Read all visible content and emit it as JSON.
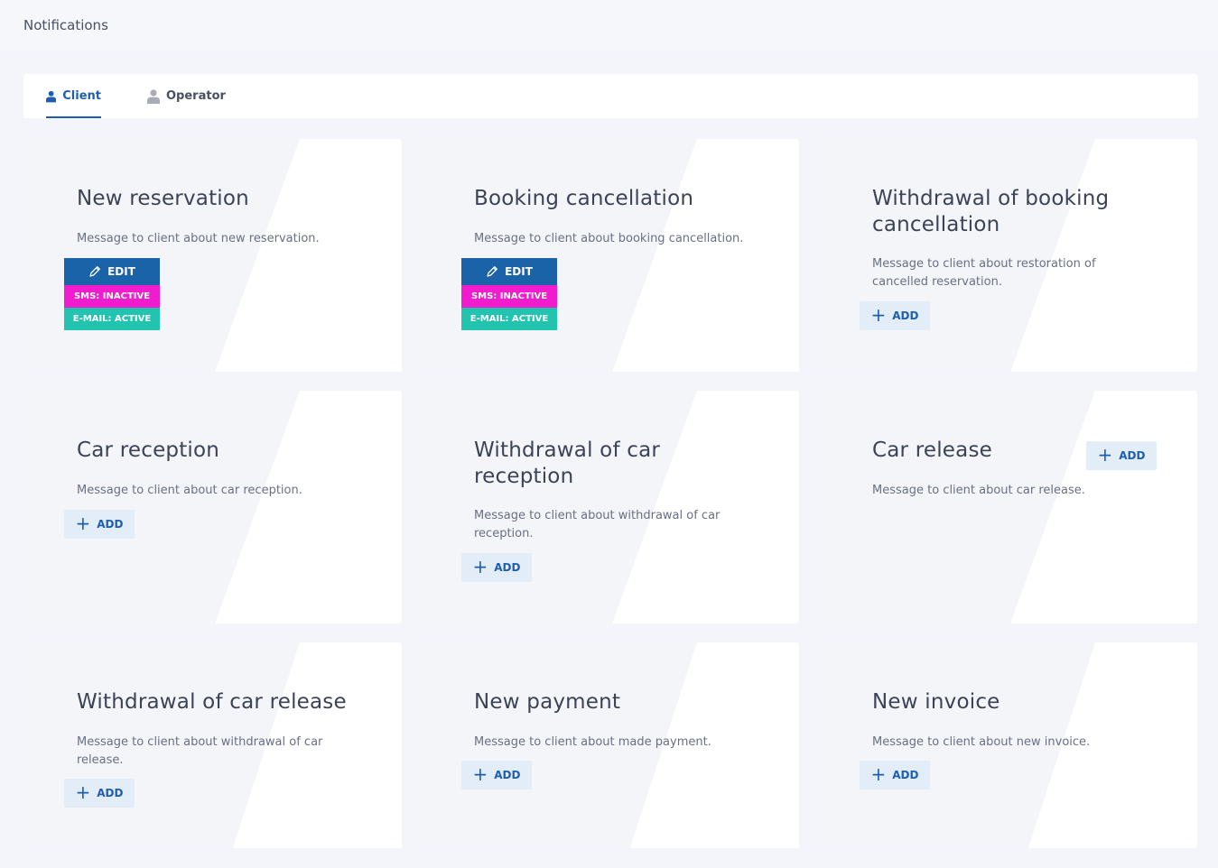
{
  "page": {
    "title": "Notifications"
  },
  "tabs": [
    {
      "label": "Client",
      "icon": "person-icon",
      "active": true
    },
    {
      "label": "Operator",
      "icon": "person-icon",
      "active": false
    }
  ],
  "colors": {
    "accent": "#1d5fae",
    "edit": "#1a63a8",
    "sms_inactive": "#f21ccf",
    "email_active": "#22c4b0",
    "add_bg": "#e2edf7"
  },
  "cards": [
    {
      "title": "New reservation",
      "description": "Message to client about new reservation.",
      "edit_label": "EDIT",
      "sms_label": "SMS: INACTIVE",
      "email_label": "E-MAIL: ACTIVE"
    },
    {
      "title": "Booking cancellation",
      "description": "Message to client about booking cancellation.",
      "edit_label": "EDIT",
      "sms_label": "SMS: INACTIVE",
      "email_label": "E-MAIL: ACTIVE"
    },
    {
      "title": "Withdrawal of booking cancellation",
      "description": "Message to client about restoration of cancelled reservation.",
      "add_label": "ADD"
    },
    {
      "title": "Car reception",
      "description": "Message to client about car reception.",
      "add_label": "ADD"
    },
    {
      "title": "Withdrawal of car reception",
      "description": "Message to client about withdrawal of car reception.",
      "add_label": "ADD"
    },
    {
      "title": "Car release",
      "description": "Message to client about car release.",
      "add_label": "ADD"
    },
    {
      "title": "Withdrawal of car release",
      "description": "Message to client about withdrawal of car release.",
      "add_label": "ADD"
    },
    {
      "title": "New payment",
      "description": "Message to client about made payment.",
      "add_label": "ADD"
    },
    {
      "title": "New invoice",
      "description": "Message to client about new invoice.",
      "add_label": "ADD"
    }
  ]
}
